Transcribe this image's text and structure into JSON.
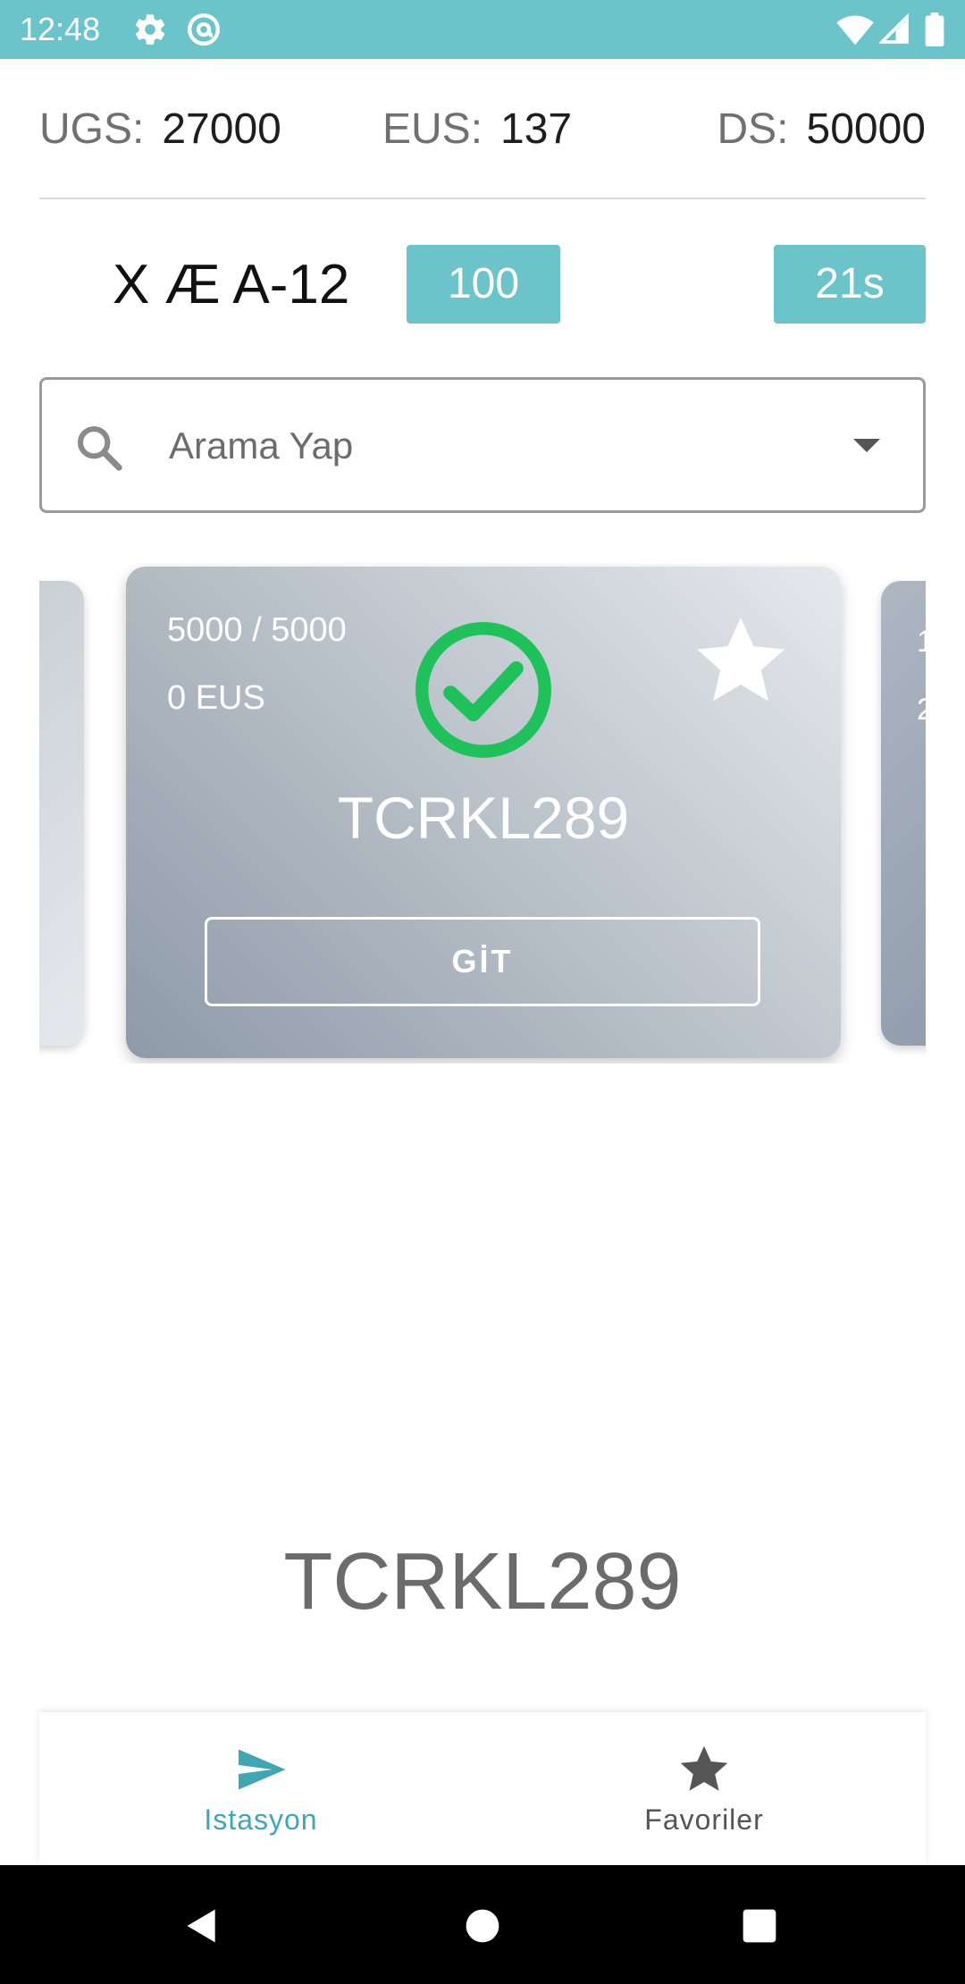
{
  "status_bar": {
    "time": "12:48",
    "icons": [
      "gear-icon",
      "at-sign-icon",
      "wifi-icon",
      "signal-icon",
      "battery-icon"
    ]
  },
  "stats": {
    "ugs_label": "UGS:",
    "ugs_value": "27000",
    "eus_label": "EUS:",
    "eus_value": "137",
    "ds_label": "DS:",
    "ds_value": "50000"
  },
  "user": {
    "name": "X Æ A-12",
    "score": "100",
    "timer": "21s"
  },
  "search": {
    "placeholder": "Arama Yap"
  },
  "carousel": {
    "right_peek_line1": "1",
    "right_peek_line2": "2",
    "active_card": {
      "balance": "5000 / 5000",
      "eus": "0 EUS",
      "station": "TCRKL289",
      "button_label": "GİT",
      "status_icon": "check-circle-icon",
      "favorite_icon": "star-icon"
    }
  },
  "selected_station": "TCRKL289",
  "bottom_nav": {
    "items": [
      {
        "label": "Istasyon",
        "icon": "send-icon",
        "active": true
      },
      {
        "label": "Favoriler",
        "icon": "star-icon",
        "active": false
      }
    ]
  },
  "colors": {
    "accent": "#6ac4ca",
    "active_nav": "#3fa7b3",
    "success": "#1fc25a"
  }
}
